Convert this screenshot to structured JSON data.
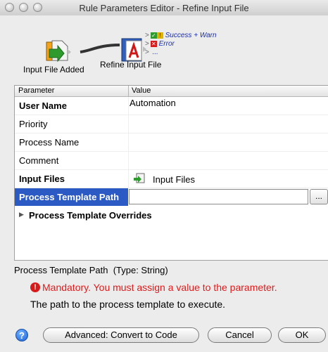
{
  "window": {
    "title": "Rule Parameters Editor - Refine Input File"
  },
  "flow": {
    "source_label": "Input File Added",
    "target_label": "Refine Input File",
    "branches": [
      "Success + Warn",
      "Error",
      "..."
    ]
  },
  "grid": {
    "headers": [
      "Parameter",
      "Value"
    ],
    "rows": [
      {
        "name": "User Name",
        "value": "Automation"
      },
      {
        "name": "Priority",
        "value": ""
      },
      {
        "name": "Process Name",
        "value": ""
      },
      {
        "name": "Comment",
        "value": ""
      },
      {
        "name": "Input Files",
        "value": "Input Files"
      },
      {
        "name": "Process Template Path",
        "value": ""
      }
    ],
    "browse_label": "...",
    "group_label": "Process Template Overrides"
  },
  "info": {
    "param_name": "Process Template Path",
    "param_type": "(Type: String)",
    "error": "Mandatory. You must assign a value to the parameter.",
    "description": "The path to the process template to execute."
  },
  "buttons": {
    "help": "?",
    "advanced": "Advanced: Convert to Code",
    "cancel": "Cancel",
    "ok": "OK"
  },
  "colors": {
    "selection": "#2b5ac5",
    "error": "#e01b1b",
    "branch": "#1a2fb0"
  }
}
